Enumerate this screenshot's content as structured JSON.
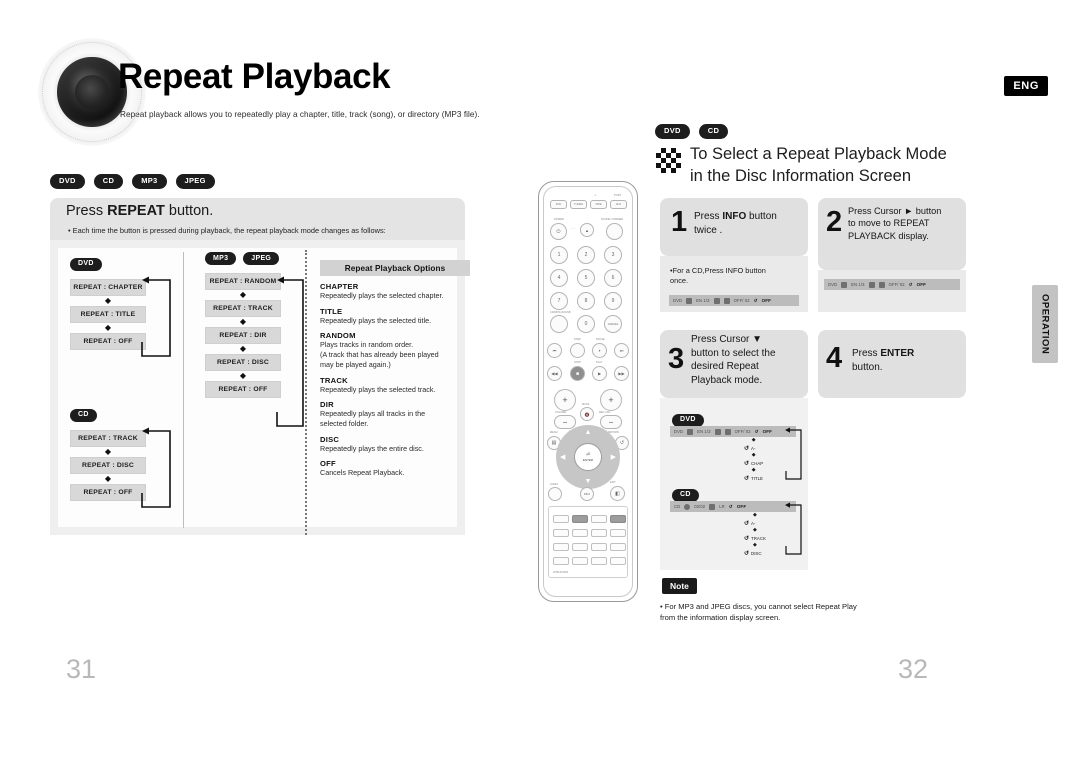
{
  "header": {
    "title": "Repeat Playback",
    "subtitle": "Repeat playback allows you to repeatedly play a chapter, title, track (song), or directory (MP3 file).",
    "language_badge": "ENG"
  },
  "left_page": {
    "page_number": "31",
    "disc_pills": [
      "DVD",
      "CD",
      "MP3",
      "JPEG"
    ],
    "instruction": {
      "prefix": "Press",
      "bold": "REPEAT",
      "suffix": "button."
    },
    "bullet": "• Each time the button is pressed during playback, the repeat playback mode changes as follows:",
    "flows": [
      {
        "label": "DVD",
        "steps": [
          "REPEAT : CHAPTER",
          "REPEAT : TITLE",
          "REPEAT : OFF"
        ]
      },
      {
        "label": "CD",
        "steps": [
          "REPEAT : TRACK",
          "REPEAT : DISC",
          "REPEAT : OFF"
        ]
      },
      {
        "labels": [
          "MP3",
          "JPEG"
        ],
        "steps": [
          "REPEAT : RANDOM",
          "REPEAT : TRACK",
          "REPEAT : DIR",
          "REPEAT : DISC",
          "REPEAT : OFF"
        ]
      }
    ],
    "options": {
      "heading": "Repeat Playback Options",
      "items": [
        {
          "term": "CHAPTER",
          "desc": "Repeatedly plays the selected chapter."
        },
        {
          "term": "TITLE",
          "desc": "Repeatedly plays the selected title."
        },
        {
          "term": "RANDOM",
          "desc": "Plays tracks in random order.\n(A track that has already been played\nmay be played again.)"
        },
        {
          "term": "TRACK",
          "desc": "Repeatedly plays the selected track."
        },
        {
          "term": "DIR",
          "desc": "Repeatedly plays all tracks in the\nselected folder."
        },
        {
          "term": "DISC",
          "desc": "Repeatedly plays the entire disc."
        },
        {
          "term": "OFF",
          "desc": "Cancels Repeat Playback."
        }
      ]
    }
  },
  "remote": {
    "name": "remote-control",
    "top_buttons": [
      "DVD",
      "TUNER",
      "TAPE",
      "AUX"
    ],
    "top_labels": [
      "-/-",
      "PORT"
    ],
    "power_label": "POWER",
    "dimmer_label": "SOUND / DIMMER",
    "numbers": [
      "1",
      "2",
      "3",
      "4",
      "5",
      "6",
      "7",
      "8",
      "9",
      "0"
    ],
    "cancel_label": "CANCEL",
    "cd_label": "CD/MP3-CD/USB",
    "transport_labels": [
      "STEP",
      "PAUSE",
      "STOP",
      "PLAY"
    ],
    "volume_label": "VOLUME",
    "mute_label": "MUTE",
    "recvol_label": "REC VOL",
    "menu_label": "MENU",
    "return_label": "RETURN",
    "enter_label": "ENTER",
    "audio_label": "AUDIO",
    "info_label": "INFO",
    "exit_label": "EXIT",
    "grid_labels": [
      "P.SCAN",
      "MO/ST",
      "STEP",
      "REPEAT",
      "SELECT",
      "NO.STEP",
      "TIMER/MEMORY",
      "SLOW",
      "P. BASS",
      "ECHO",
      "ZOOM",
      "AUDIO/MIC",
      "SET/CS",
      "SCAN ON",
      "TIME/CLOCK",
      "LOGO",
      "TIMER",
      "ON/OFF"
    ],
    "model": "AH59-01301B"
  },
  "right_page": {
    "page_number": "32",
    "disc_pills": [
      "DVD",
      "CD"
    ],
    "section_title_line1": "To Select a Repeat Playback Mode",
    "section_title_line2": "in the Disc Information Screen",
    "steps": [
      {
        "number": "1",
        "text_html": "Press <b>INFO</b> button<br>twice ."
      },
      {
        "number": "2",
        "text_html": "Press Cursor ► button<br>to move to REPEAT<br>PLAYBACK display."
      },
      {
        "number": "3",
        "text_html": "Press Cursor ▼<br>button to select the<br>desired Repeat<br>Playback mode."
      },
      {
        "number": "4",
        "text_html": "Press <b>ENTER</b><br>button."
      }
    ],
    "step1_note": "•For a  CD,Press INFO button\nonce.",
    "osd_bars": {
      "dvd": [
        "DVD",
        "EN 1/3",
        "OFF/ 02",
        "OFF"
      ],
      "cd": [
        "CD",
        "02/02",
        "LR",
        "OFF"
      ]
    },
    "osd_flows": [
      {
        "label": "DVD",
        "steps": [
          "OFF",
          "A-",
          "CHAP",
          "TITLE"
        ]
      },
      {
        "label": "CD",
        "steps": [
          "OFF",
          "A-",
          "TRACK",
          "DISC"
        ]
      }
    ],
    "note": {
      "badge": "Note",
      "text": "• For MP3 and JPEG discs, you cannot select Repeat Play\n   from the information display screen."
    },
    "side_tab": "OPERATION"
  }
}
